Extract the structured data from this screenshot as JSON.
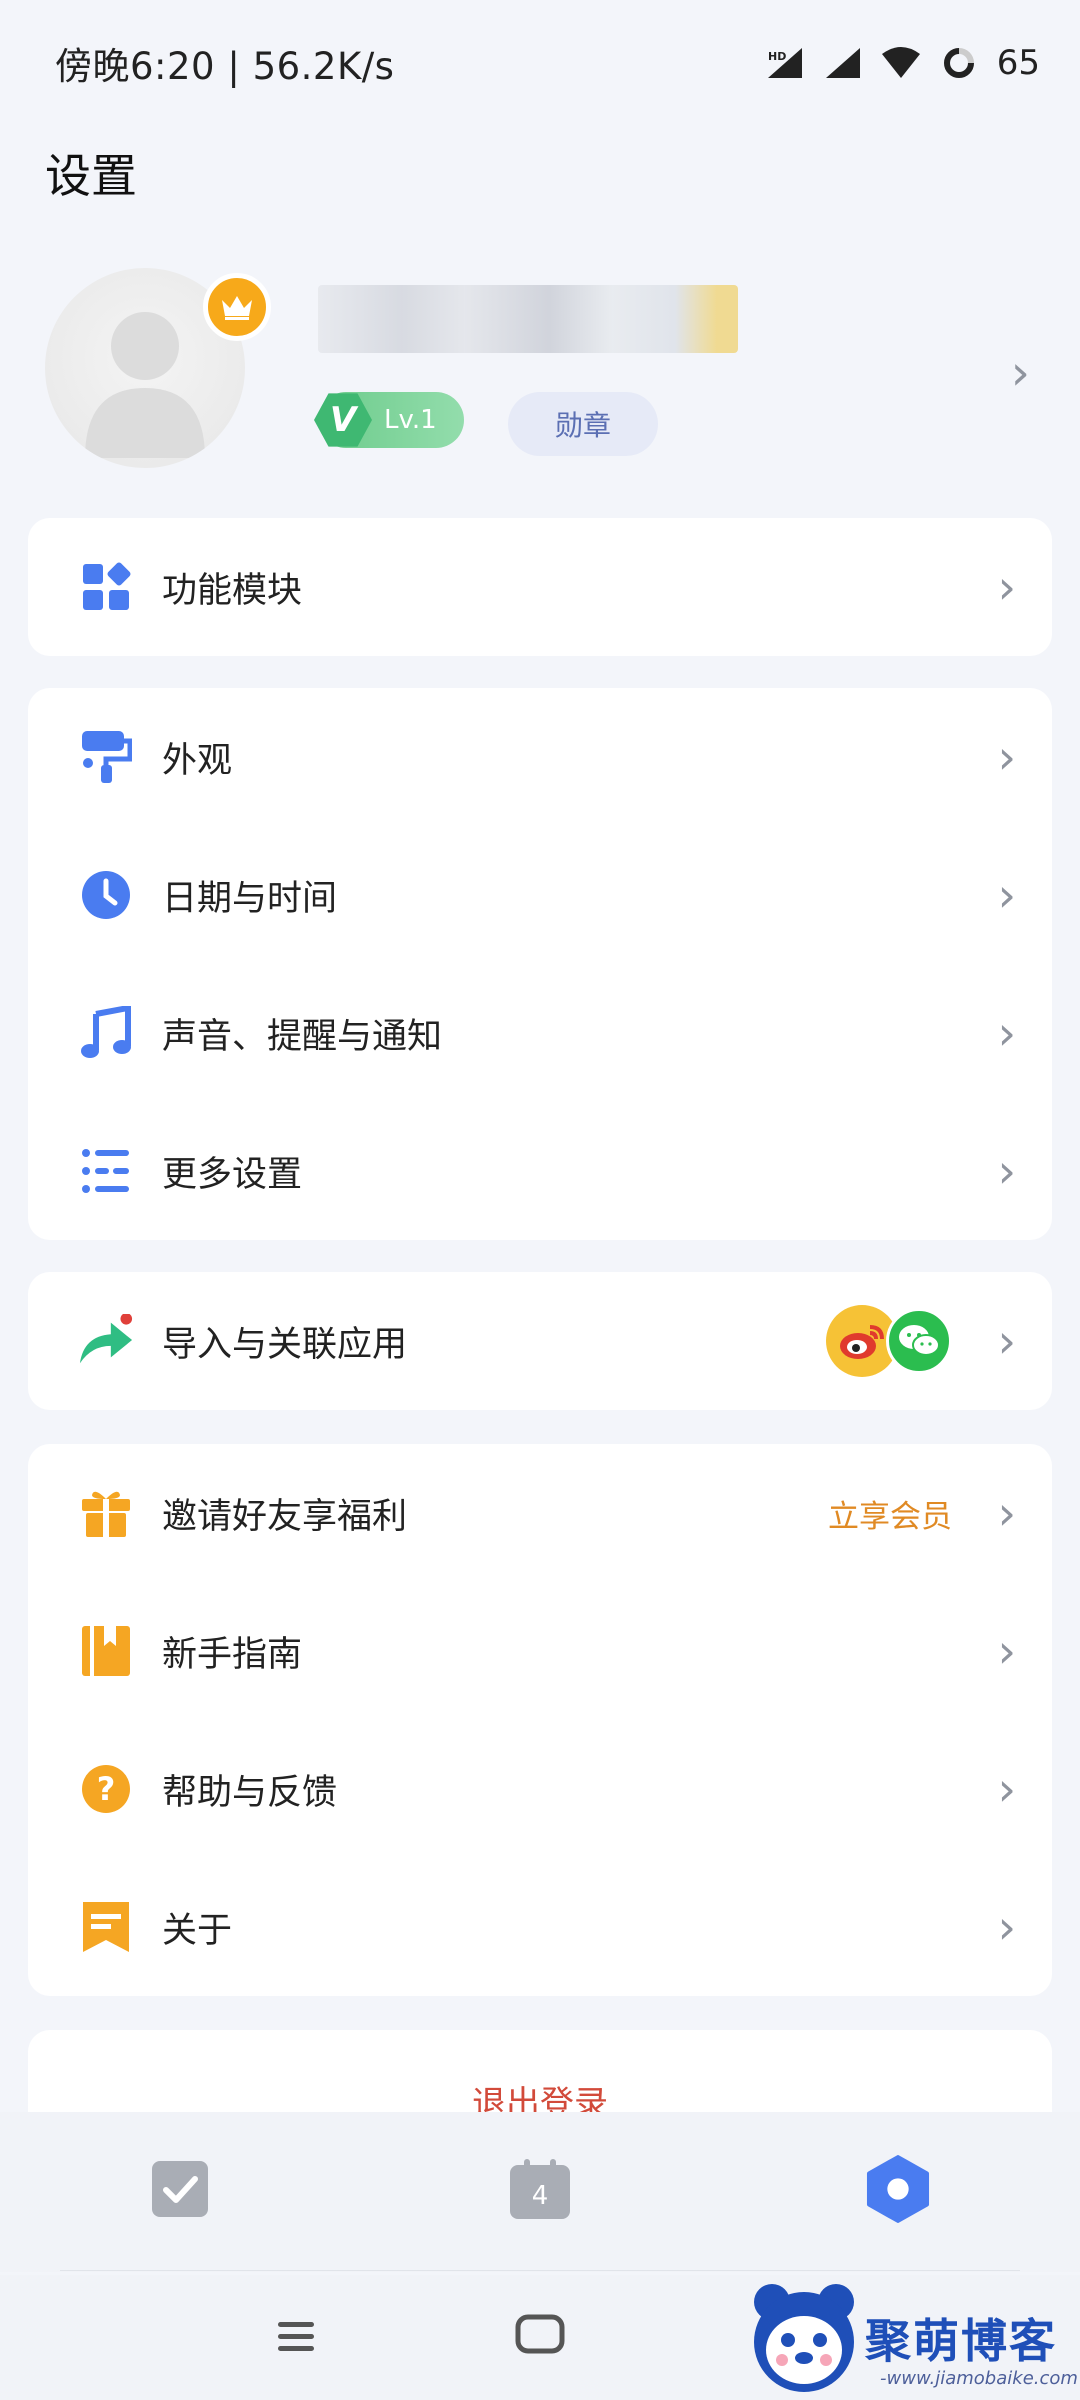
{
  "status_bar": {
    "time_speed": "傍晚6:20 | 56.2K/s",
    "battery": "65"
  },
  "page": {
    "title": "设置"
  },
  "profile": {
    "level_badge": "Lv.1",
    "level_mark": "V",
    "medal_label": "勋章"
  },
  "cards": {
    "modules": {
      "label": "功能模块"
    },
    "appearance": {
      "label": "外观"
    },
    "datetime": {
      "label": "日期与时间"
    },
    "sound": {
      "label": "声音、提醒与通知"
    },
    "more": {
      "label": "更多设置"
    },
    "import": {
      "label": "导入与关联应用"
    },
    "invite": {
      "label": "邀请好友享福利",
      "extra": "立享会员"
    },
    "guide": {
      "label": "新手指南"
    },
    "help": {
      "label": "帮助与反馈"
    },
    "about": {
      "label": "关于"
    }
  },
  "logout": {
    "label": "退出登录"
  },
  "tabs": {
    "calendar_day": "4"
  },
  "watermark": {
    "title": "聚萌博客",
    "subtitle": "-www.jiamobaike.com"
  },
  "colors": {
    "blue_icon": "#4a7cf0",
    "yellow_icon": "#f5a623",
    "green_icon": "#2fbd83",
    "accent_orange": "#e08a24",
    "logout_red": "#d24a3a"
  }
}
